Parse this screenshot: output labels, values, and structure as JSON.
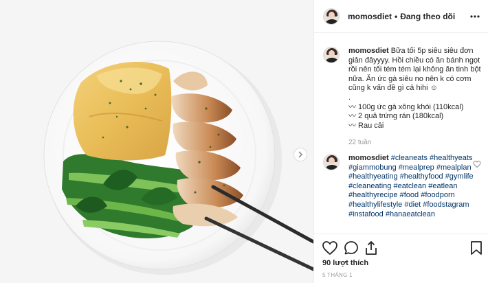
{
  "post": {
    "username": "momosdiet",
    "dot": "•",
    "follow_label": "Đang theo dõi",
    "more_icon": "more-horizontal-icon",
    "caption": {
      "username": "momosdiet",
      "text": "Bữa tối 5p siêu siêu đơn giản đâyyyy. Hồi chiều có ăn bánh ngọt rồi nên tối tém tém lại không ăn tinh bột nữa. Ăn ức gà siêu no nên k có cơm cũng k vấn đề gì cả hihi ☺",
      "lines": ".\n〰 100g ức gà xông khói (110kcal)\n〰 2 quả trứng rán (180kcal)\n〰 Rau cải",
      "time": "22 tuần"
    },
    "hashtag_comment": {
      "username": "momosdiet",
      "tags": [
        "#cleaneats",
        "#healthyeats",
        "#giammobung",
        "#mealprep",
        "#mealplan",
        "#healthyeating",
        "#healthyfood",
        "#gymlife",
        "#cleaneating",
        "#eatclean",
        "#eatlean",
        "#healthyrecipe",
        "#food",
        "#foodporn",
        "#healthylifestyle",
        "#diet",
        "#foodstagram",
        "#instafood",
        "#hanaeatclean"
      ]
    },
    "likes": "90 lượt thích",
    "date": "5 THÁNG 1",
    "colors": {
      "link": "#003569",
      "muted": "#999999",
      "text": "#262626",
      "border": "#efefef"
    }
  }
}
